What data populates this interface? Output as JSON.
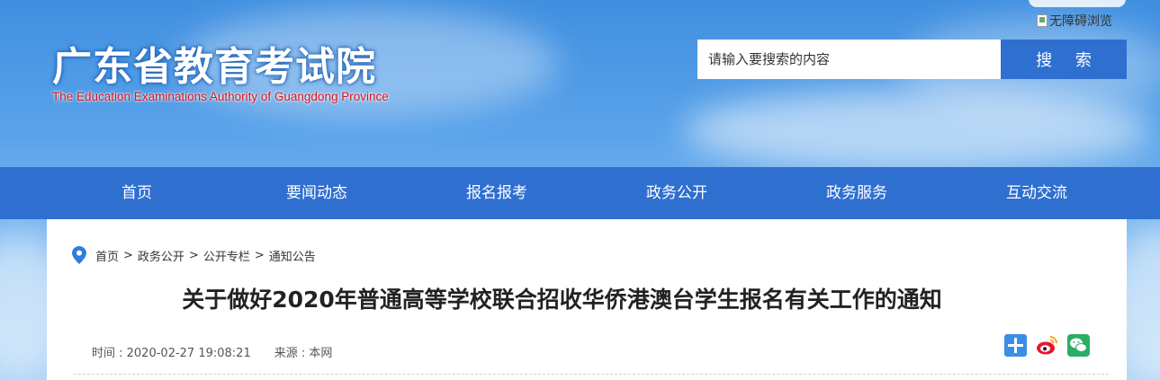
{
  "header": {
    "title": "广东省教育考试院",
    "subtitle": "The Education Examinations Authority of Guangdong Province",
    "accessibility_link": "无障碍浏览",
    "search": {
      "placeholder": "请输入要搜索的内容",
      "button_label": "搜 索"
    }
  },
  "nav": {
    "items": [
      {
        "label": "首页"
      },
      {
        "label": "要闻动态"
      },
      {
        "label": "报名报考"
      },
      {
        "label": "政务公开"
      },
      {
        "label": "政务服务"
      },
      {
        "label": "互动交流"
      }
    ]
  },
  "breadcrumb": {
    "items": [
      "首页",
      "政务公开",
      "公开专栏",
      "通知公告"
    ],
    "separator": ">"
  },
  "article": {
    "title": "关于做好2020年普通高等学校联合招收华侨港澳台学生报名有关工作的通知",
    "time": "时间 : 2020-02-27 19:08:21",
    "source": "来源 : 本网"
  },
  "share": {
    "icons": [
      "add-share-icon",
      "weibo-icon",
      "wechat-icon"
    ]
  },
  "colors": {
    "primary": "#2f6fd0",
    "logo_subtitle": "#d4101d"
  }
}
